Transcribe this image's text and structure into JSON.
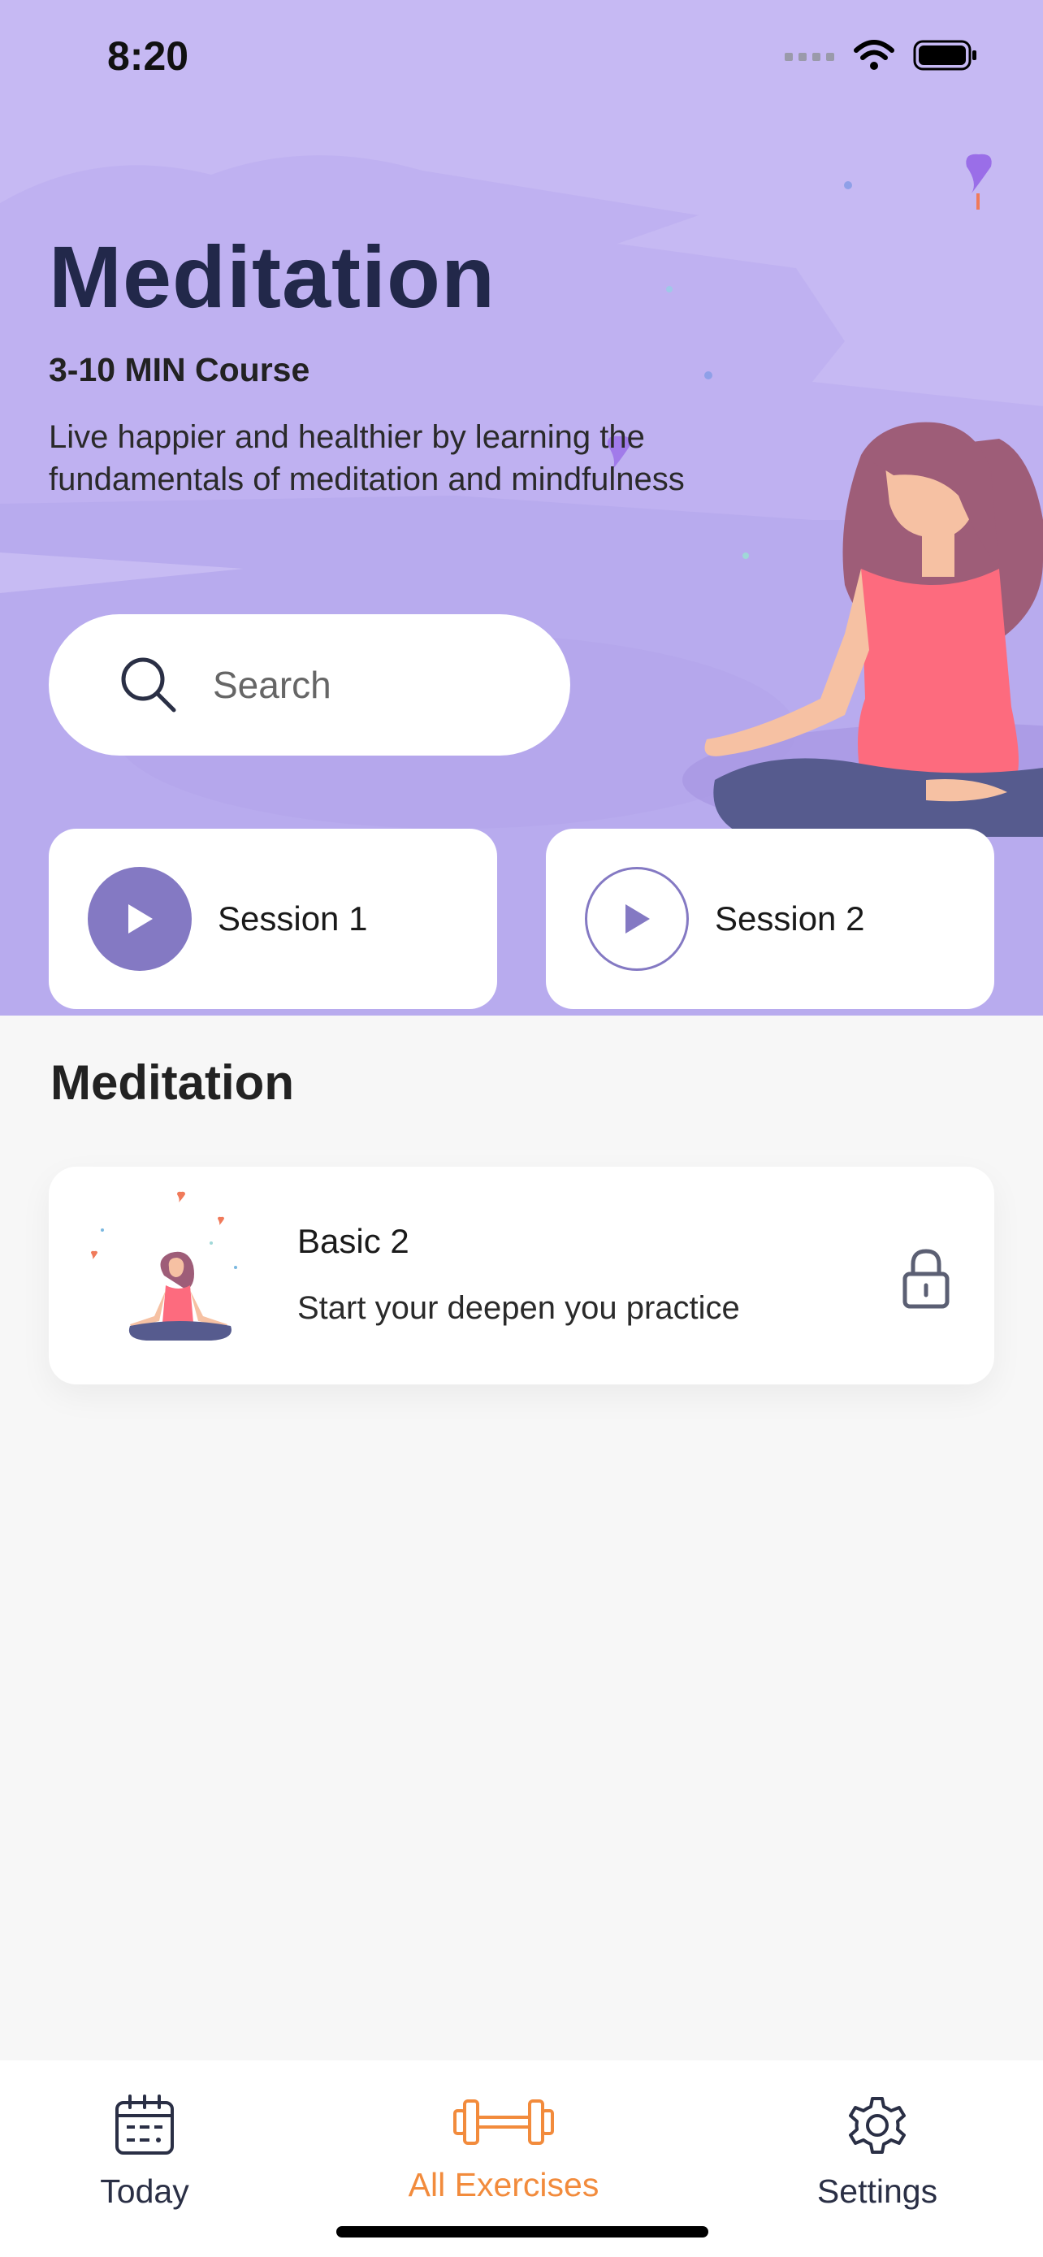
{
  "status_bar": {
    "time": "8:20"
  },
  "hero": {
    "title": "Meditation",
    "subtitle": "3-10 MIN Course",
    "description": "Live happier and healthier by learning the fundamentals of meditation and mindfulness"
  },
  "search": {
    "placeholder": "Search"
  },
  "sessions": [
    {
      "label": "Session 1",
      "style": "filled"
    },
    {
      "label": "Session 2",
      "style": "outline"
    }
  ],
  "section": {
    "title": "Meditation"
  },
  "course": {
    "title": "Basic 2",
    "description": "Start your deepen you practice",
    "icon": "lock-icon"
  },
  "tabs": [
    {
      "label": "Today",
      "icon": "calendar-icon",
      "active": false
    },
    {
      "label": "All Exercises",
      "icon": "dumbbell-icon",
      "active": true
    },
    {
      "label": "Settings",
      "icon": "gear-icon",
      "active": false
    }
  ],
  "colors": {
    "hero_bg": "#c6b9f3",
    "accent_purple": "#8479c3",
    "active_tab": "#f28b3c",
    "title_dark": "#22284a"
  }
}
